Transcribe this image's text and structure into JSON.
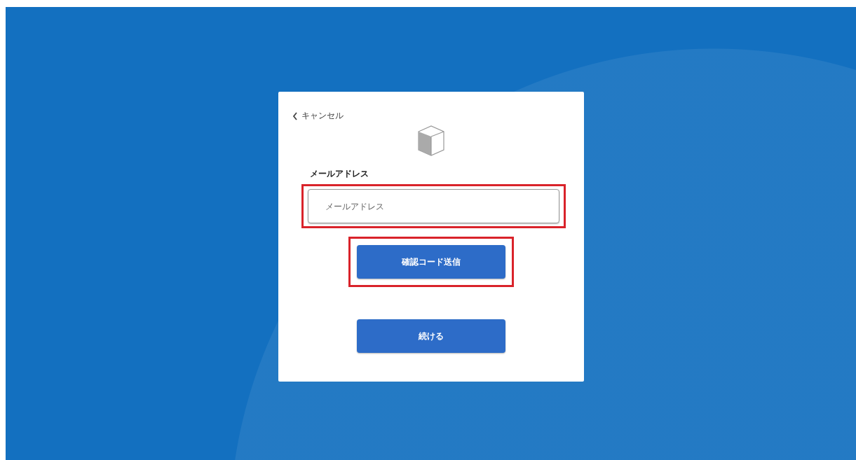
{
  "card": {
    "cancel_link": {
      "label": "キャンセル"
    },
    "email_field": {
      "label": "メールアドレス",
      "placeholder": "メールアドレス",
      "highlighted": true
    },
    "buttons": [
      {
        "label": "確認コード送信",
        "highlighted": true
      },
      {
        "label": "続ける",
        "highlighted": false
      }
    ]
  }
}
